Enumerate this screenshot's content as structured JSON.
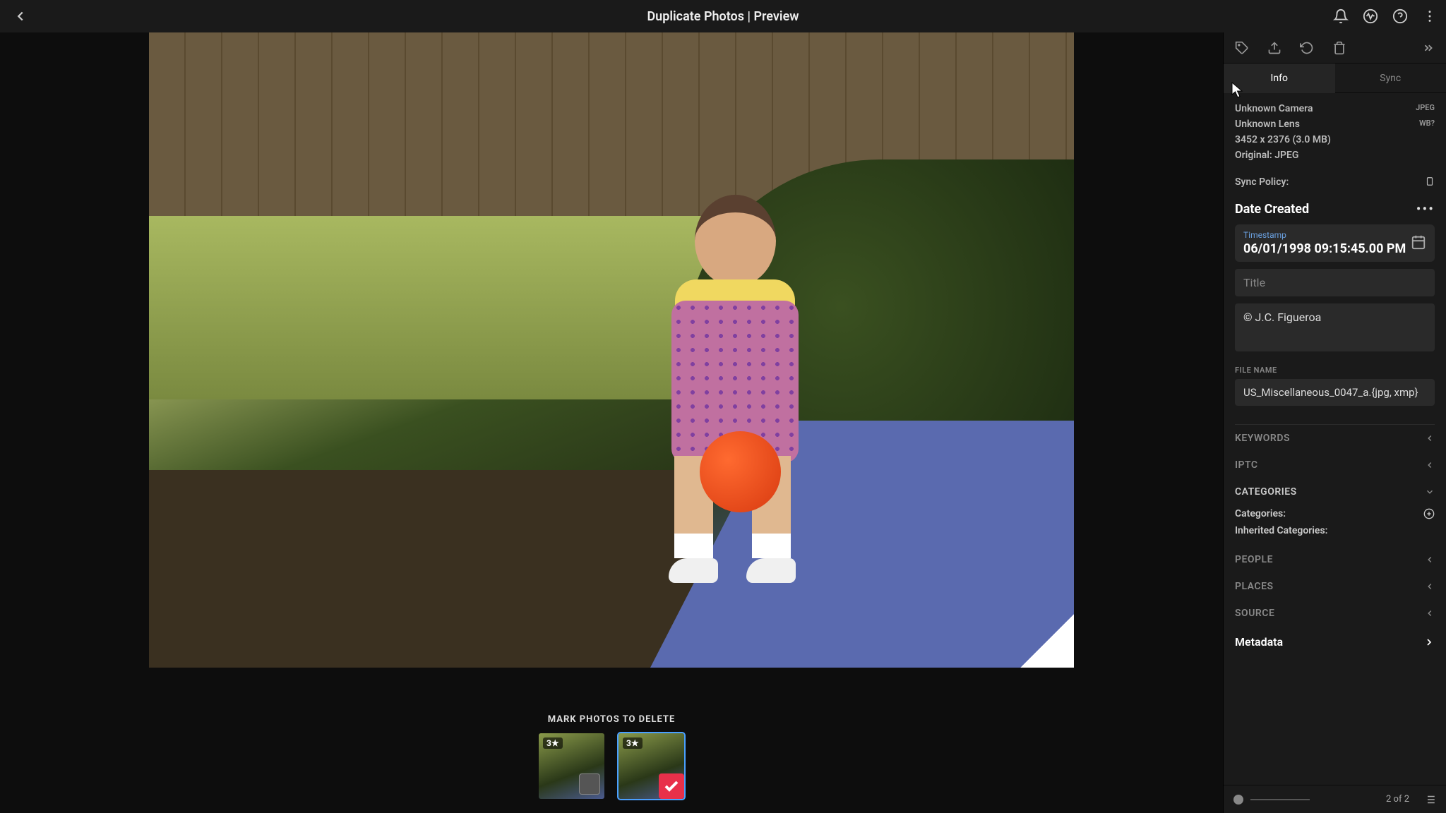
{
  "header": {
    "title": "Duplicate Photos | Preview"
  },
  "strip": {
    "label": "MARK PHOTOS TO DELETE",
    "thumbs": [
      {
        "rating": "3★",
        "marked": false,
        "selected": false
      },
      {
        "rating": "3★",
        "marked": true,
        "selected": true
      }
    ]
  },
  "panel": {
    "tabs": {
      "info": "Info",
      "sync": "Sync"
    },
    "meta": {
      "camera": "Unknown Camera",
      "lens": "Unknown Lens",
      "dimensions": "3452 x 2376 (3.0 MB)",
      "original": "Original: JPEG",
      "badge1": "JPEG",
      "badge2": "WB?"
    },
    "sync_policy_label": "Sync Policy:",
    "date_section": "Date Created",
    "timestamp_label": "Timestamp",
    "timestamp_value": "06/01/1998 09:15:45.00 PM",
    "title_placeholder": "Title",
    "copyright": "© J.C. Figueroa",
    "filename_label": "FILE NAME",
    "filename_value": "US_Miscellaneous_0047_a.{jpg, xmp}",
    "sections": {
      "keywords": "KEYWORDS",
      "iptc": "IPTC",
      "categories": "CATEGORIES",
      "categories_line": "Categories:",
      "inherited_line": "Inherited Categories:",
      "people": "PEOPLE",
      "places": "PLACES",
      "source": "SOURCE",
      "metadata": "Metadata"
    },
    "footer_count": "2 of 2"
  }
}
